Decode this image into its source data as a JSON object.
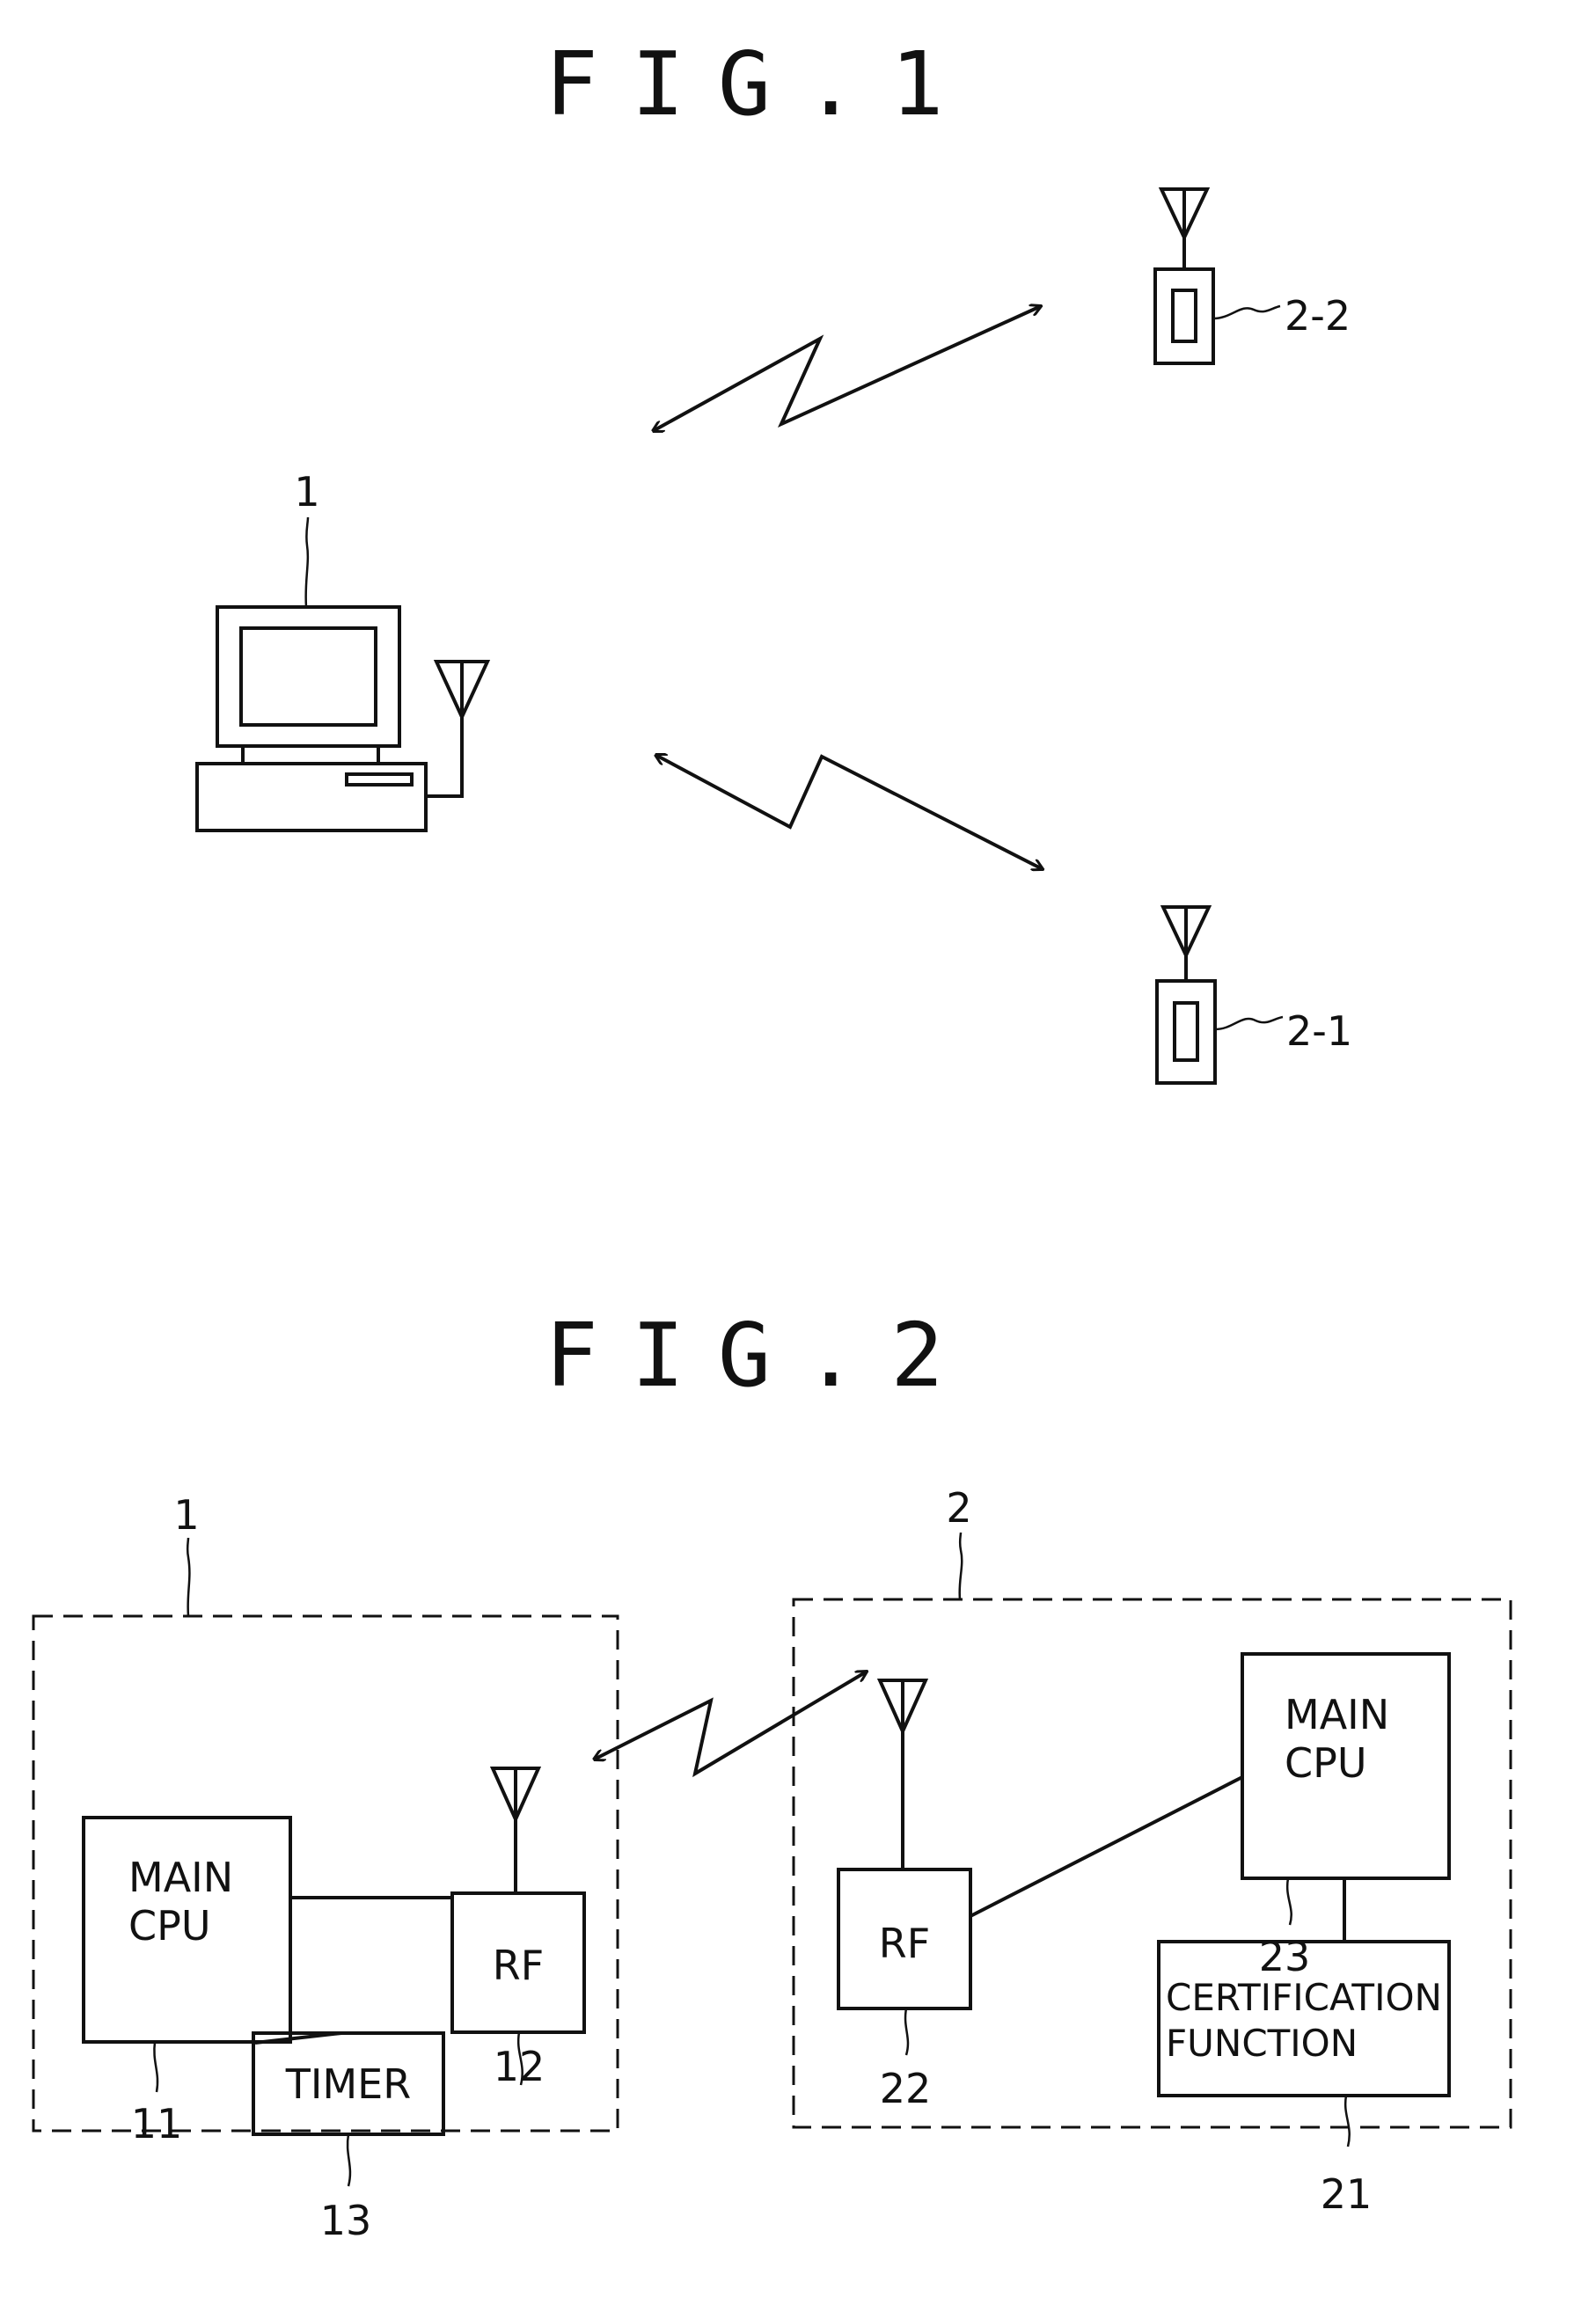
{
  "fig1": {
    "title": "FIG.1",
    "computer_label": "1",
    "device_top_label": "2-2",
    "device_bottom_label": "2-1"
  },
  "fig2": {
    "title": "FIG.2",
    "host": {
      "label": "1",
      "main_cpu": {
        "line1": "MAIN",
        "line2": "CPU",
        "ref": "11"
      },
      "rf": {
        "text": "RF",
        "ref": "12"
      },
      "timer": {
        "text": "TIMER",
        "ref": "13"
      }
    },
    "device": {
      "label": "2",
      "rf": {
        "text": "RF",
        "ref": "22"
      },
      "main_cpu": {
        "line1": "MAIN",
        "line2": "CPU",
        "ref": "23"
      },
      "certification": {
        "line1": "CERTIFICATION",
        "line2": "FUNCTION",
        "ref": "21"
      }
    }
  }
}
